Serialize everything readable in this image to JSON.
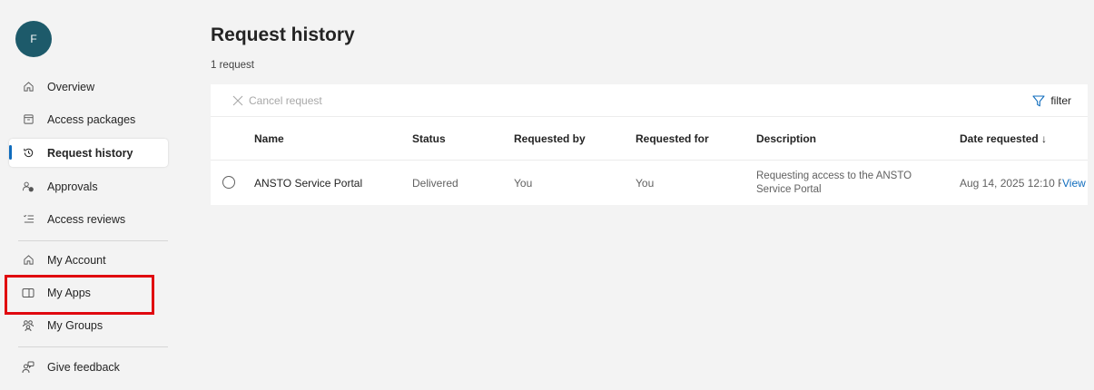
{
  "user": {
    "initial": "F"
  },
  "sidebar": {
    "items": [
      {
        "label": "Overview",
        "icon": "home-icon"
      },
      {
        "label": "Access packages",
        "icon": "package-icon"
      },
      {
        "label": "Request history",
        "icon": "history-icon",
        "active": true
      },
      {
        "label": "Approvals",
        "icon": "approvals-icon"
      },
      {
        "label": "Access reviews",
        "icon": "checklist-icon"
      },
      {
        "label": "My Account",
        "icon": "home-icon"
      },
      {
        "label": "My Apps",
        "icon": "apps-icon"
      },
      {
        "label": "My Groups",
        "icon": "groups-icon"
      },
      {
        "label": "Give feedback",
        "icon": "feedback-icon"
      }
    ]
  },
  "main": {
    "title": "Request history",
    "subtitle": "1 request",
    "toolbar": {
      "cancel_label": "Cancel request",
      "filter_label": "filter"
    },
    "table": {
      "headers": [
        "Name",
        "Status",
        "Requested by",
        "Requested for",
        "Description",
        "Date requested ↓"
      ],
      "rows": [
        {
          "name": "ANSTO Service Portal",
          "status": "Delivered",
          "requested_by": "You",
          "requested_for": "You",
          "description": "Requesting access to the ANSTO Service Portal",
          "date": "Aug 14, 2025 12:10 F",
          "action": "View"
        }
      ]
    }
  },
  "colors": {
    "accent": "#0f6cbd",
    "avatar": "#1d5a6a",
    "highlight": "#e0080f"
  }
}
